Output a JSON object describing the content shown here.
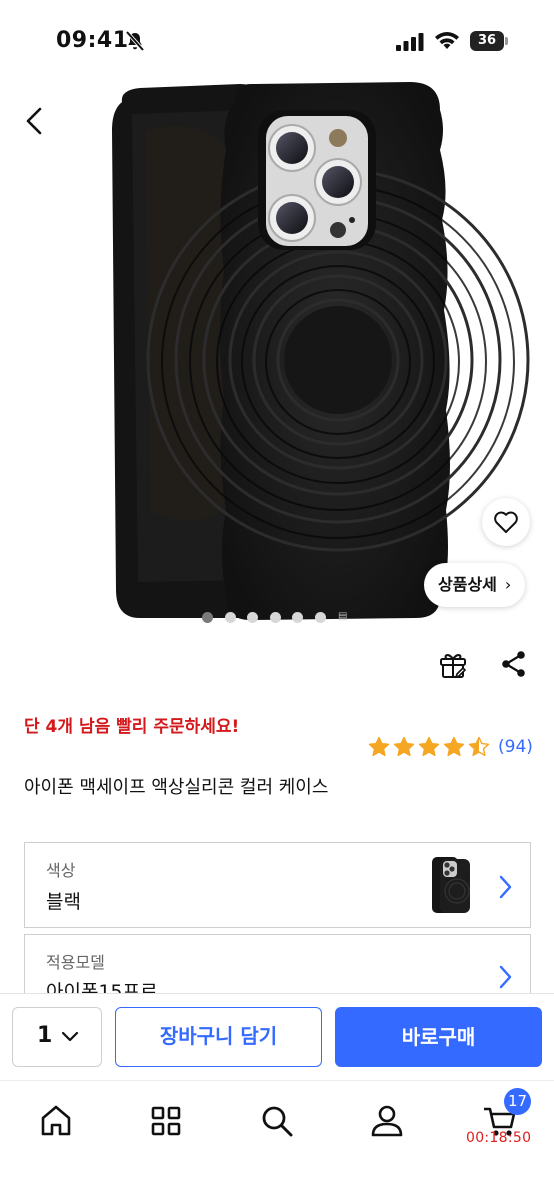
{
  "status_bar": {
    "time": "09:41",
    "battery": "36"
  },
  "product": {
    "stock_alert": "단 4개 남음 빨리 주문하세요!",
    "rating": 4.5,
    "rating_count": "(94)",
    "title": "아이폰 맥세이프 액상실리콘 컬러 케이스",
    "detail_button_label": "상품상세",
    "image_count": 7,
    "active_image_index": 0
  },
  "options": [
    {
      "label": "색상",
      "value": "블랙"
    },
    {
      "label": "적용모델",
      "value": "아이폰15프로"
    }
  ],
  "purchase_bar": {
    "quantity": "1",
    "cart_label": "장바구니 담기",
    "buy_label": "바로구매"
  },
  "tab_bar": {
    "items": [
      "home-icon",
      "category-icon",
      "search-icon",
      "my-page-icon",
      "cart-icon"
    ],
    "cart_badge": "17",
    "cart_timer": "00:18:50"
  },
  "colors": {
    "accent": "#346aff",
    "alert": "#d3191c",
    "star": "#f5a623"
  }
}
